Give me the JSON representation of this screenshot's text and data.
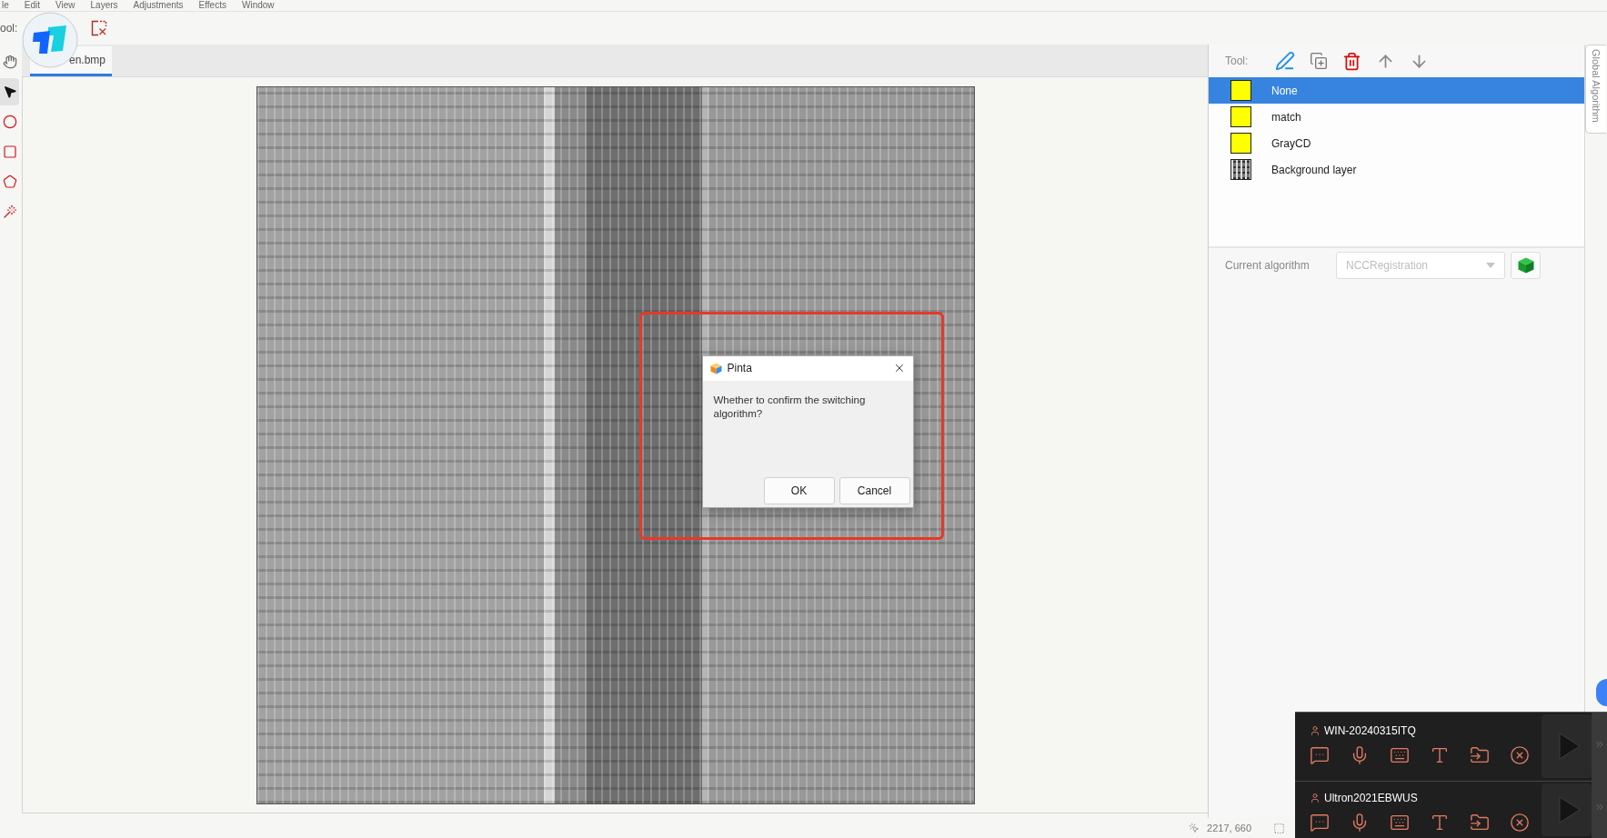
{
  "menu_bar": {
    "items": [
      "le",
      "Edit",
      "View",
      "Layers",
      "Adjustments",
      "Effects",
      "Window"
    ]
  },
  "toolbar": {
    "label": "ool:"
  },
  "tools": [
    {
      "kind": "hand",
      "selected": false
    },
    {
      "kind": "pointer",
      "selected": true
    },
    {
      "kind": "ellipse",
      "selected": false
    },
    {
      "kind": "rectangle",
      "selected": false
    },
    {
      "kind": "lasso",
      "selected": false
    },
    {
      "kind": "wand",
      "selected": false
    }
  ],
  "document_tabs": [
    {
      "label": "en.bmp",
      "selected": true
    }
  ],
  "dialog": {
    "title": "Pinta",
    "message": "Whether to confirm the switching algorithm?",
    "buttons": [
      "OK",
      "Cancel"
    ]
  },
  "layers_panel": {
    "tool_label": "Tool:",
    "layers": [
      {
        "name": "None",
        "kind": "swatch",
        "selected": true
      },
      {
        "name": "match",
        "kind": "swatch",
        "selected": false
      },
      {
        "name": "GrayCD",
        "kind": "swatch",
        "selected": false
      },
      {
        "name": "Background layer",
        "kind": "thumbnail",
        "selected": false
      }
    ],
    "algorithm": {
      "label": "Current algorithm",
      "value": "NCCRegistration",
      "disabled": true
    }
  },
  "side_tab": {
    "label": "Global Algorithm"
  },
  "status_bar": {
    "position": "2217, 660"
  },
  "remote_panel": {
    "sessions": [
      {
        "name": "WIN-20240315ITQ"
      },
      {
        "name": "Ultron2021EBWUS"
      }
    ]
  }
}
